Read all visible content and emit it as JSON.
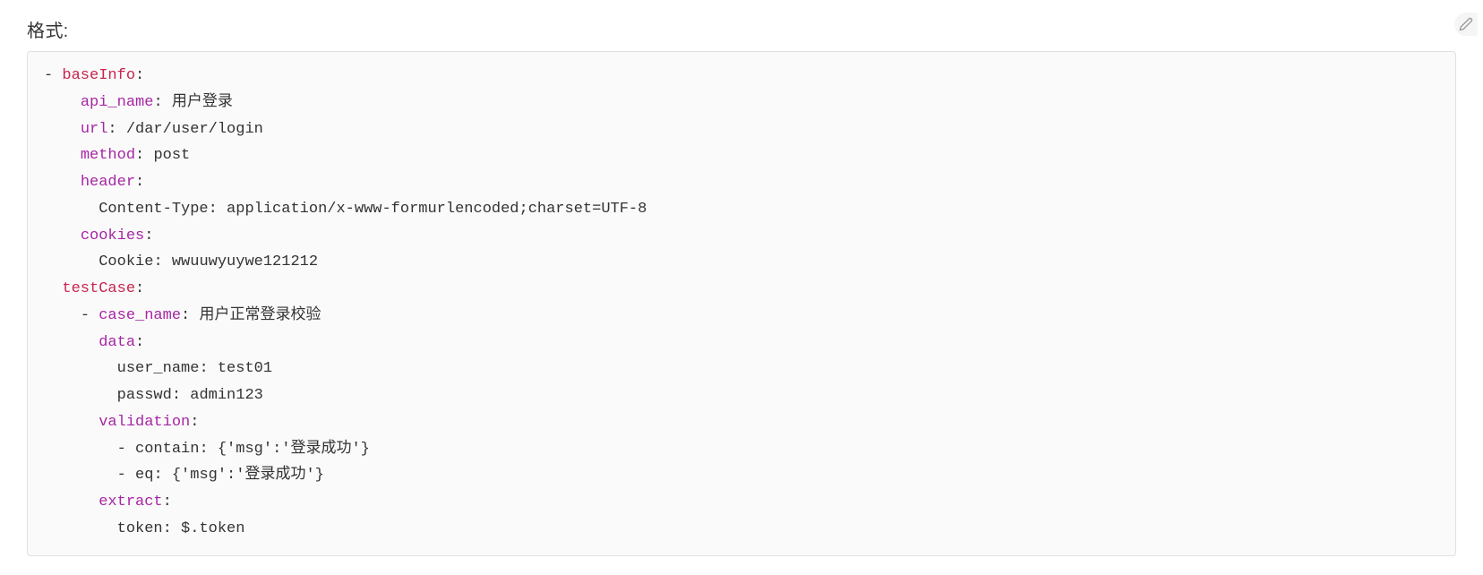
{
  "title": "格式:",
  "dash": "-",
  "colon": ":",
  "code": {
    "baseInfo": {
      "key": "baseInfo",
      "api_name": {
        "key": "api_name",
        "value": "用户登录"
      },
      "url": {
        "key": "url",
        "value": "/dar/user/login"
      },
      "method": {
        "key": "method",
        "value": "post"
      },
      "header": {
        "key": "header",
        "content_type": {
          "key": "Content-Type",
          "value": "application/x-www-formurlencoded;charset=UTF-8"
        }
      },
      "cookies": {
        "key": "cookies",
        "cookie": {
          "key": "Cookie",
          "value": "wwuuwyuywe121212"
        }
      }
    },
    "testCase": {
      "key": "testCase",
      "case_name": {
        "key": "case_name",
        "value": "用户正常登录校验"
      },
      "data": {
        "key": "data",
        "user_name": {
          "key": "user_name",
          "value": "test01"
        },
        "passwd": {
          "key": "passwd",
          "value": "admin123"
        }
      },
      "validation": {
        "key": "validation",
        "contain": {
          "key": "contain",
          "value": "{'msg':'登录成功'}"
        },
        "eq": {
          "key": "eq",
          "value": "{'msg':'登录成功'}"
        }
      },
      "extract": {
        "key": "extract",
        "token": {
          "key": "token",
          "value": "$.token"
        }
      }
    }
  }
}
